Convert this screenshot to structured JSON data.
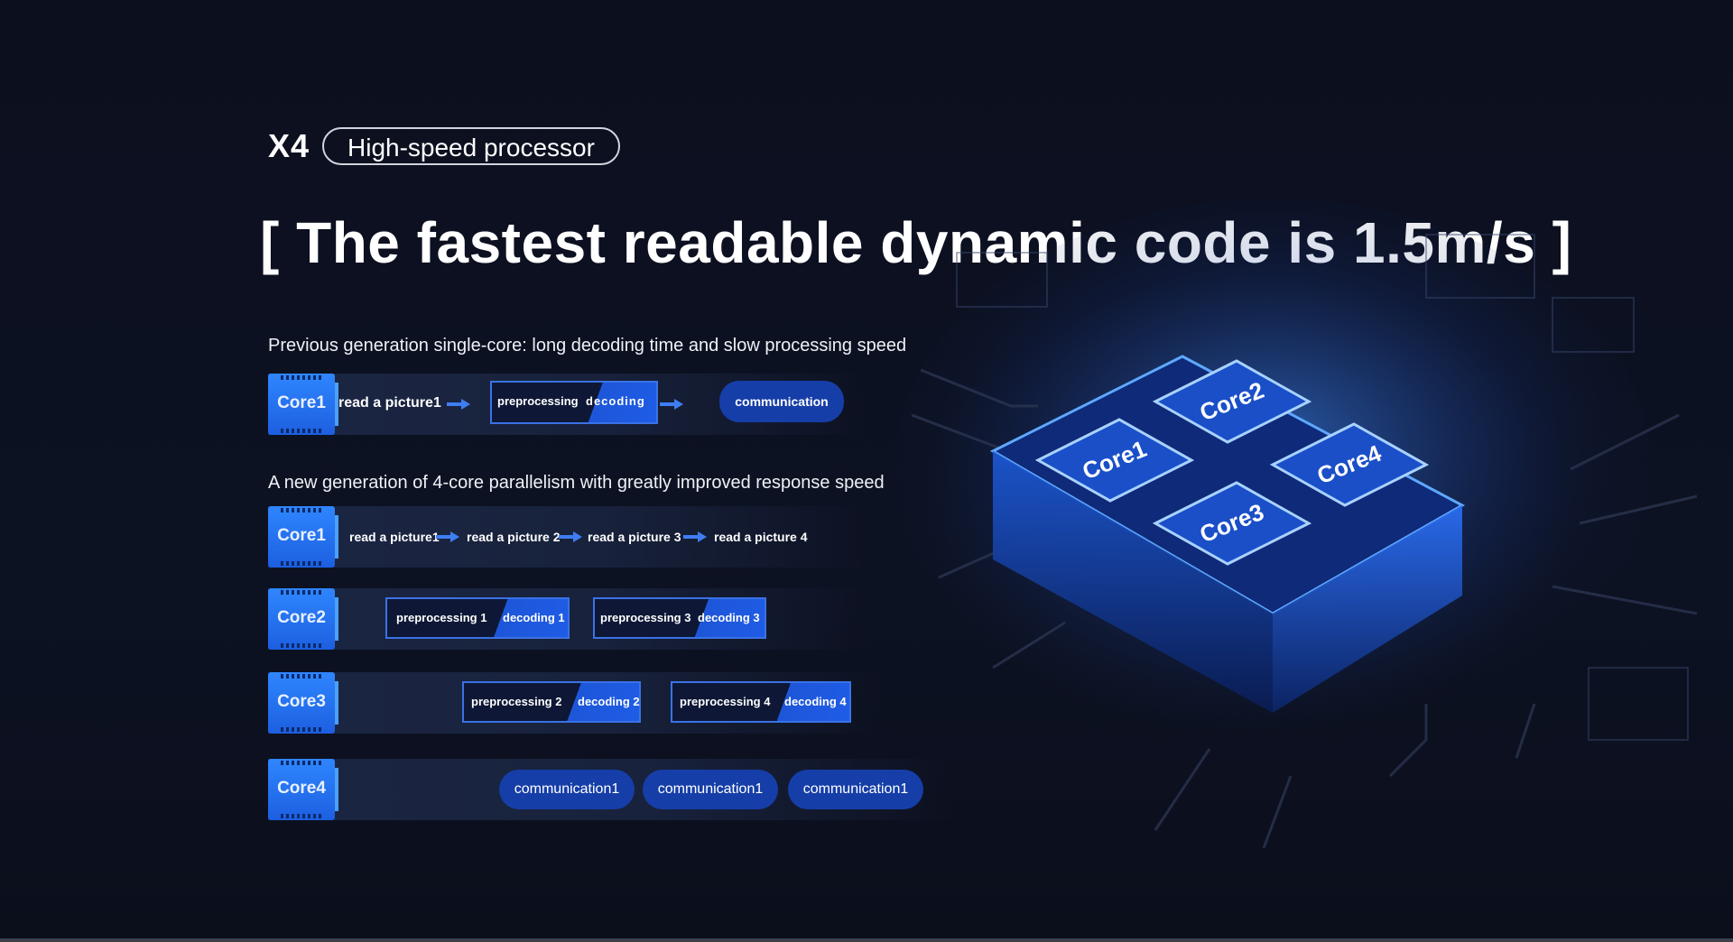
{
  "header": {
    "model": "X4",
    "pill_label": "High-speed processor",
    "headline": "[ The fastest readable dynamic code is 1.5m/s ]"
  },
  "single_core": {
    "subtitle": "Previous generation single-core: long decoding time and slow processing speed",
    "core_label": "Core1",
    "read": "read a picture1",
    "preprocessing": "preprocessing",
    "decoding": "decoding",
    "communication": "communication"
  },
  "multi_core": {
    "subtitle": "A new generation of 4-core parallelism with greatly improved response speed",
    "cores": [
      {
        "label": "Core1",
        "reads": [
          "read a picture1",
          "read a picture  2",
          "read a picture 3",
          "read a picture 4"
        ]
      },
      {
        "label": "Core2",
        "boxes": [
          {
            "pre": "preprocessing 1",
            "dec": "decoding 1"
          },
          {
            "pre": "preprocessing 3",
            "dec": "decoding 3"
          }
        ]
      },
      {
        "label": "Core3",
        "boxes": [
          {
            "pre": "preprocessing 2",
            "dec": "decoding 2"
          },
          {
            "pre": "preprocessing 4",
            "dec": "decoding 4"
          }
        ]
      },
      {
        "label": "Core4",
        "comms": [
          "communication1",
          "communication1",
          "communication1"
        ]
      }
    ]
  },
  "chip_art": {
    "labels": [
      "Core1",
      "Core2",
      "Core3",
      "Core4"
    ],
    "accent": "#2f86ff"
  }
}
